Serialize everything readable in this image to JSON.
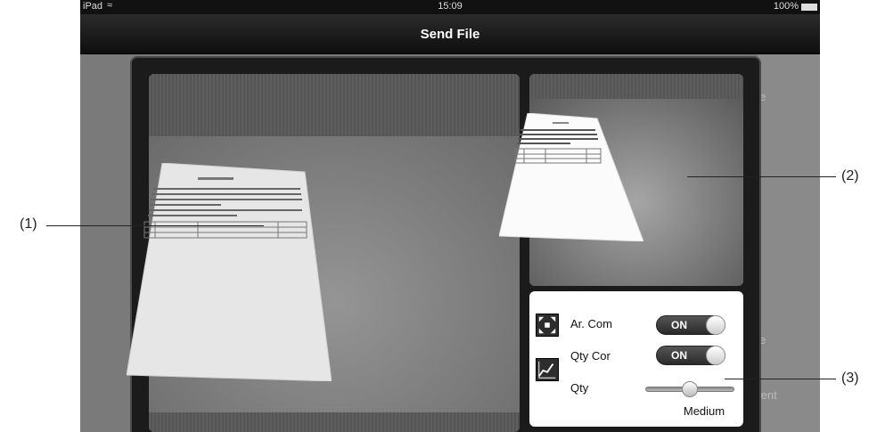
{
  "status_bar": {
    "carrier": "iPad",
    "time": "15:09",
    "battery": "100%"
  },
  "nav": {
    "title": "Send File"
  },
  "side": {
    "fragment1": "e",
    "fragment2": "e",
    "fragment3": "rrent"
  },
  "settings": {
    "area_compensation_label": "Ar. Com",
    "area_compensation_toggle": "ON",
    "quality_correction_label": "Qty Cor",
    "quality_correction_toggle": "ON",
    "quality_label": "Qty",
    "quality_value": "Medium",
    "quality_level": 0.5
  },
  "callouts": {
    "c1": "(1)",
    "c2": "(2)",
    "c3": "(3)"
  },
  "icons": [
    "wifi-icon",
    "battery-icon",
    "area-compensation-icon",
    "quality-correction-icon"
  ]
}
